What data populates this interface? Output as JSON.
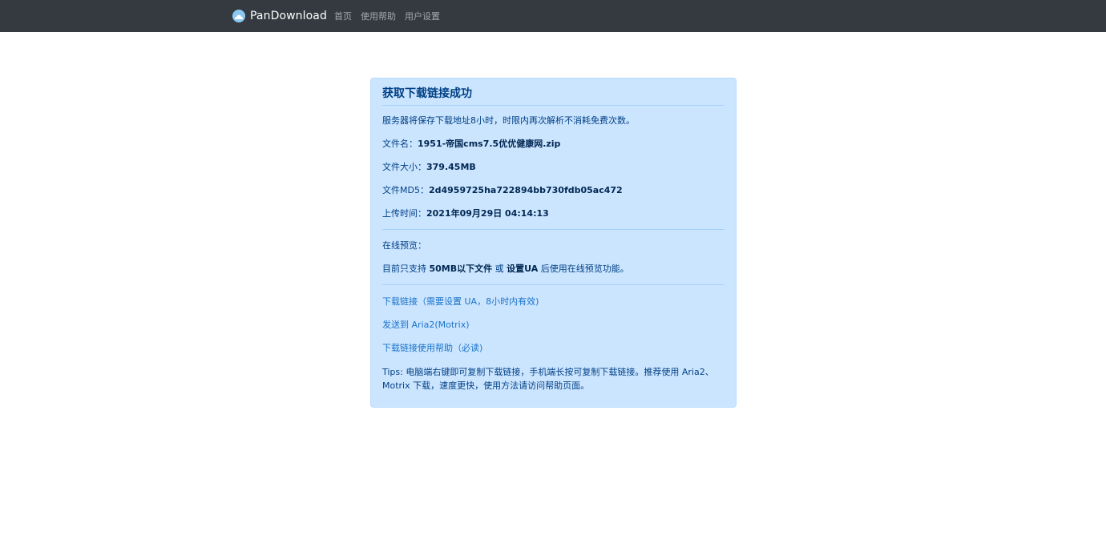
{
  "navbar": {
    "brand": "PanDownload",
    "links": [
      "首页",
      "使用帮助",
      "用户设置"
    ]
  },
  "card": {
    "title": "获取下载链接成功",
    "notice": "服务器将保存下载地址8小时，时限内再次解析不消耗免费次数。",
    "filename_label": "文件名：",
    "filename": "1951-帝国cms7.5优优健康网.zip",
    "size_label": "文件大小：",
    "size": "379.45MB",
    "md5_label": "文件MD5：",
    "md5": "2d4959725ha722894bb730fdb05ac472",
    "upload_label": "上传时间：",
    "upload_time": "2021年09月29日 04:14:13",
    "preview_label": "在线预览：",
    "preview_prefix": "目前只支持 ",
    "preview_limit": "50MB以下文件",
    "preview_or": " 或 ",
    "preview_setua": "设置UA",
    "preview_suffix": " 后使用在线预览功能。",
    "link_download": "下载链接（需要设置 UA，8小时内有效)",
    "link_aria2": "发送到 Aria2(Motrix)",
    "link_help": "下载链接使用帮助（必读)",
    "tips": "Tips: 电脑端右键即可复制下载链接，手机端长按可复制下载链接。推荐使用 Aria2、Motrix 下载，速度更快，使用方法请访问帮助页面。"
  },
  "colors": {
    "navbar_bg": "#343a40",
    "card_bg": "#cce5ff",
    "card_text": "#004085",
    "link": "#1a73c8"
  }
}
